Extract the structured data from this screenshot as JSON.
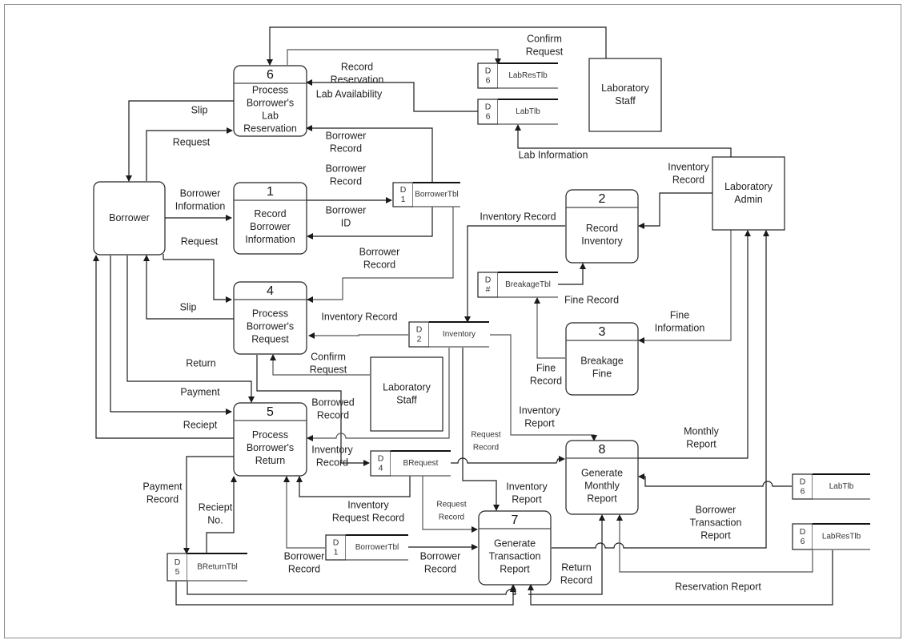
{
  "diagram": {
    "type": "data-flow-diagram",
    "processes": [
      {
        "id": "6",
        "lines": [
          "Process",
          "Borrower's",
          "Lab",
          "Reservation"
        ]
      },
      {
        "id": "1",
        "lines": [
          "Record",
          "Borrower",
          "Information"
        ]
      },
      {
        "id": "2",
        "lines": [
          "Record",
          "Inventory"
        ]
      },
      {
        "id": "4",
        "lines": [
          "Process",
          "Borrower's",
          "Request"
        ]
      },
      {
        "id": "3",
        "lines": [
          "Breakage",
          "Fine"
        ]
      },
      {
        "id": "5",
        "lines": [
          "Process",
          "Borrower's",
          "Return"
        ]
      },
      {
        "id": "8",
        "lines": [
          "Generate",
          "Monthly",
          "Report"
        ]
      },
      {
        "id": "7",
        "lines": [
          "Generate",
          "Transaction",
          "Report"
        ]
      }
    ],
    "entities": [
      {
        "key": "borrower",
        "lines": [
          "Borrower"
        ]
      },
      {
        "key": "lab-staff-top",
        "lines": [
          "Laboratory",
          "Staff"
        ]
      },
      {
        "key": "lab-admin",
        "lines": [
          "Laboratory",
          "Admin"
        ]
      },
      {
        "key": "lab-staff-mid",
        "lines": [
          "Laboratory",
          "Staff"
        ]
      }
    ],
    "stores": [
      {
        "key": "labrestlb-top",
        "d": "D",
        "n": "6",
        "name": "LabResTlb"
      },
      {
        "key": "labtlb-top",
        "d": "D",
        "n": "6",
        "name": "LabTlb"
      },
      {
        "key": "borrowertbl-top",
        "d": "D",
        "n": "1",
        "name": "BorrowerTbl"
      },
      {
        "key": "breakagetbl",
        "d": "D",
        "n": "#",
        "name": "BreakageTbl"
      },
      {
        "key": "inventory",
        "d": "D",
        "n": "2",
        "name": "Inventory"
      },
      {
        "key": "brequest",
        "d": "D",
        "n": "4",
        "name": "BRequest"
      },
      {
        "key": "borrowertbl-bottom",
        "d": "D",
        "n": "1",
        "name": "BorrowerTbl"
      },
      {
        "key": "breturntbl",
        "d": "D",
        "n": "5",
        "name": "BReturnTbl"
      },
      {
        "key": "labtlb-right",
        "d": "D",
        "n": "6",
        "name": "LabTlb"
      },
      {
        "key": "labrestlb-right",
        "d": "D",
        "n": "6",
        "name": "LabResTlb"
      }
    ],
    "flow_labels": {
      "confirm_request_top": [
        "Confirm",
        "Request"
      ],
      "record_reservation": [
        "Record",
        "Reservation"
      ],
      "lab_availability": [
        "Lab Availability"
      ],
      "slip_top": [
        "Slip"
      ],
      "request_top": [
        "Request"
      ],
      "borrower_record_6": [
        "Borrower",
        "Record"
      ],
      "lab_information": [
        "Lab Information"
      ],
      "borrower_record_1": [
        "Borrower",
        "Record"
      ],
      "borrower_information": [
        "Borrower",
        "Information"
      ],
      "borrower_id": [
        "Borrower",
        "ID"
      ],
      "inventory_record_admin": [
        "Inventory",
        "Record"
      ],
      "inventory_record_2": [
        "Inventory Record"
      ],
      "request_4": [
        "Request"
      ],
      "borrower_record_4": [
        "Borrower",
        "Record"
      ],
      "slip_4": [
        "Slip"
      ],
      "inventory_record_4": [
        "Inventory Record"
      ],
      "fine_record_store": [
        "Fine Record"
      ],
      "fine_information": [
        "Fine",
        "Information"
      ],
      "confirm_request_mid": [
        "Confirm",
        "Request"
      ],
      "return": [
        "Return"
      ],
      "fine_record_3": [
        "Fine",
        "Record"
      ],
      "payment": [
        "Payment"
      ],
      "borrowed_record": [
        "Borrowed",
        "Record"
      ],
      "inventory_report_8": [
        "Inventory",
        "Report"
      ],
      "reciept": [
        "Reciept"
      ],
      "request_record_8": [
        "Request",
        "Record"
      ],
      "monthly_report": [
        "Monthly",
        "Report"
      ],
      "inventory_record_5": [
        "Inventory",
        "Record"
      ],
      "payment_record": [
        "Payment",
        "Record"
      ],
      "inventory_report_7": [
        "Inventory",
        "Report"
      ],
      "reciept_no": [
        "Reciept",
        "No."
      ],
      "request_record_7": [
        "Request",
        "Record"
      ],
      "inventory_request_record": [
        "Inventory",
        "Request Record"
      ],
      "borrower_transaction_report": [
        "Borrower",
        "Transaction",
        "Report"
      ],
      "borrower_record_5": [
        "Borrower",
        "Record"
      ],
      "borrower_record_7": [
        "Borrower",
        "Record"
      ],
      "return_record": [
        "Return",
        "Record"
      ],
      "reservation_report": [
        "Reservation Report"
      ]
    }
  }
}
